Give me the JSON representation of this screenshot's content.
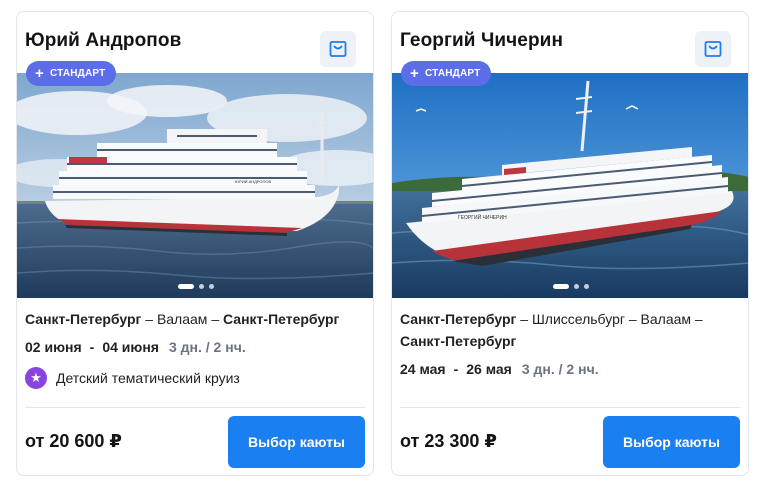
{
  "cruises": [
    {
      "ship_name": "Юрий Андропов",
      "badge": "СТАНДАРТ",
      "route": {
        "start": "Санкт-Петербург",
        "sep1": " – ",
        "middle": "Валаам",
        "sep2": " – ",
        "end": "Санкт-Петербург"
      },
      "date_from": "02 июня",
      "date_sep": "-",
      "date_to": "04 июня",
      "duration": "3 дн. / 2 нч.",
      "theme": "Детский тематический круиз",
      "price": "от 20 600 ₽",
      "button": "Выбор каюты",
      "ship_label": "ЮРИЙ АНДРОПОВ"
    },
    {
      "ship_name": "Георгий Чичерин",
      "badge": "СТАНДАРТ",
      "route": {
        "start": "Санкт-Петербург",
        "sep1": " – ",
        "middle": "Шлиссельбург – Валаам",
        "sep2": " – ",
        "end": "Санкт-Петербург"
      },
      "date_from": "24 мая",
      "date_sep": "-",
      "date_to": "26 мая",
      "duration": "3 дн. / 2 нч.",
      "price": "от 23 300 ₽",
      "button": "Выбор каюты",
      "ship_label": "ГЕОРГИЙ ЧИЧЕРИН"
    }
  ],
  "icons": {
    "favorite": "bag-icon",
    "badge": "plus-icon",
    "theme": "star-icon"
  },
  "colors": {
    "badge": "#5b6ee8",
    "button": "#1a7ff0",
    "theme_icon": "#8a45e0",
    "fav_icon": "#1a7ff0"
  }
}
